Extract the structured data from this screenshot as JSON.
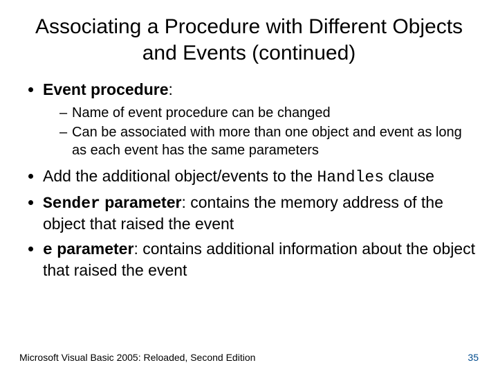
{
  "title": "Associating a Procedure with Different Objects and Events (continued)",
  "bullets": {
    "b1_label": "Event procedure",
    "b1_colon": ":",
    "b1_sub1": "Name of event procedure can be changed",
    "b1_sub2": "Can be associated with more than one object and event as long as each event has the same parameters",
    "b2_pre": "Add the additional object/events to the ",
    "b2_code": "Handles",
    "b2_post": " clause",
    "b3_code": "Sender",
    "b3_label": " parameter",
    "b3_rest": ": contains the memory address of the object that raised the event",
    "b4_code": "e",
    "b4_label": " parameter",
    "b4_rest": ": contains additional information about the object that raised the event"
  },
  "footer": {
    "left": "Microsoft Visual Basic 2005: Reloaded, Second Edition",
    "page": "35"
  }
}
